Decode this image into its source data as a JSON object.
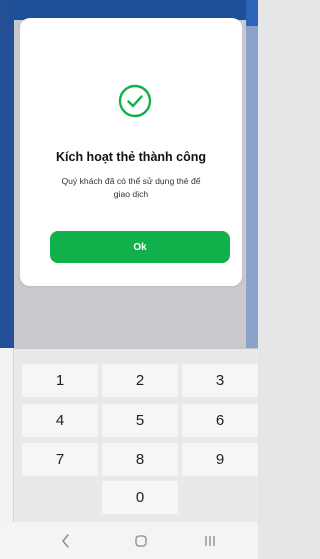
{
  "dialog": {
    "title": "Kích hoạt thẻ thành công",
    "message": "Quý khách đã có thể sử dụng thẻ để giao dịch",
    "ok_label": "Ok",
    "icon": "check-circle-icon"
  },
  "keypad": {
    "keys": [
      "1",
      "2",
      "3",
      "4",
      "5",
      "6",
      "7",
      "8",
      "9",
      "0"
    ]
  },
  "nav": {
    "back": "back-icon",
    "home": "home-icon",
    "recent": "recent-apps-icon"
  },
  "colors": {
    "accent": "#12b04b",
    "app_header": "#1e4f9a"
  }
}
